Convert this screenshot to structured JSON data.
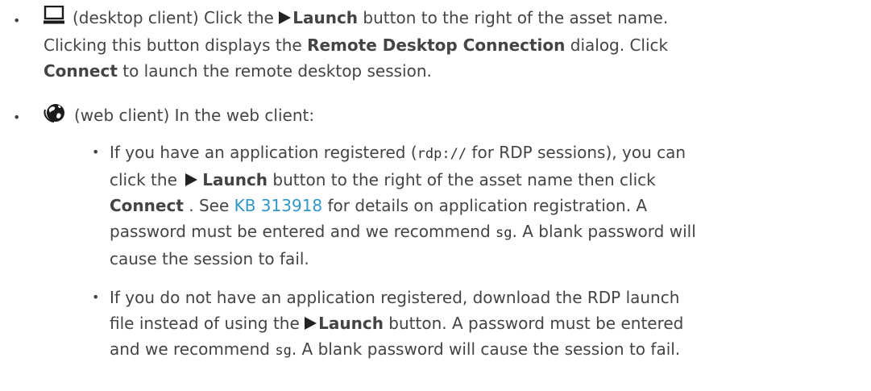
{
  "bullet_char": "•",
  "item1": {
    "line1_intro": "(desktop client) Click the ",
    "line1_launch": "Launch",
    "line1_rest": " button to the right of the asset name.",
    "line2_intro": "Clicking this button displays the ",
    "line2_bold": "Remote Desktop Connection",
    "line2_rest": " dialog. Click",
    "line3_bold": "Connect",
    "line3_rest": " to launch the remote desktop session.",
    "icon": "monitor-icon"
  },
  "item2": {
    "intro": "(web client) In the web client:",
    "icon": "globe-icon",
    "sub1": {
      "l1_intro": "If you have an application registered (",
      "l1_code": "rdp://",
      "l1_rest": " for RDP sessions), you can",
      "l2_intro": "click the ",
      "l2_launch": "Launch",
      "l2_rest": " button to the right of the asset name then click",
      "l3_bold": "Connect",
      "l3_mid": " . See ",
      "l3_link": "KB 313918",
      "l3_rest": " for details on application registration. A",
      "l4_intro": "password must be entered and we recommend ",
      "l4_code": "sg",
      "l4_rest": ". A blank password will",
      "l5": "cause the session to fail."
    },
    "sub2": {
      "l1": "If you do not have an application registered, download the RDP launch",
      "l2_intro": "file instead of using the ",
      "l2_launch": "Launch",
      "l2_rest": " button. A password must be entered",
      "l3_intro": "and we recommend ",
      "l3_code": "sg",
      "l3_rest": ". A blank password will cause the session to fail."
    }
  },
  "colors": {
    "text": "#444444",
    "link": "#2f97c9",
    "icon_dark": "#1a1a1a"
  }
}
